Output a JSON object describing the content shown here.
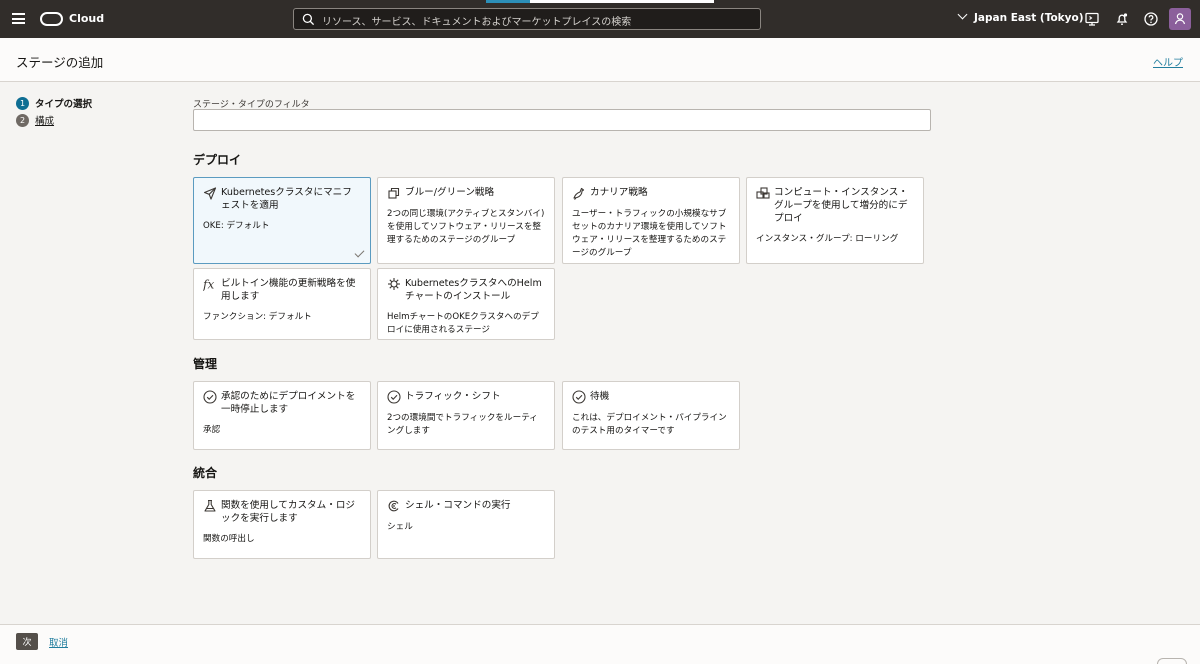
{
  "topbar": {
    "brand": "Cloud",
    "search_placeholder": "リソース、サービス、ドキュメントおよびマーケットプレイスの検索",
    "region": "Japan East (Tokyo)"
  },
  "header": {
    "title": "ステージの追加",
    "help": "ヘルプ"
  },
  "steps": [
    {
      "num": "1",
      "label": "タイプの選択"
    },
    {
      "num": "2",
      "label": "構成"
    }
  ],
  "filter": {
    "label": "ステージ・タイプのフィルタ",
    "value": ""
  },
  "sections": {
    "deploy": "デプロイ",
    "manage": "管理",
    "integration": "統合"
  },
  "cards": {
    "oke": {
      "title": "Kubernetesクラスタにマニフェストを適用",
      "desc": "OKE: デフォルト"
    },
    "bluegreen": {
      "title": "ブルー/グリーン戦略",
      "desc": "2つの同じ環境(アクティブとスタンバイ)を使用してソフトウェア・リリースを整理するためのステージのグループ"
    },
    "canary": {
      "title": "カナリア戦略",
      "desc": "ユーザー・トラフィックの小規模なサブセットのカナリア環境を使用してソフトウェア・リリースを整理するためのステージのグループ"
    },
    "instance": {
      "title": "コンピュート・インスタンス・グループを使用して増分的にデプロイ",
      "desc": "インスタンス・グループ: ローリング"
    },
    "function": {
      "title": "ビルトイン機能の更新戦略を使用します",
      "desc": "ファンクション: デフォルト"
    },
    "helm": {
      "title": "KubernetesクラスタへのHelmチャートのインストール",
      "desc": "HelmチャートのOKEクラスタへのデプロイに使用されるステージ"
    },
    "approval": {
      "title": "承認のためにデプロイメントを一時停止します",
      "desc": "承認"
    },
    "traffic": {
      "title": "トラフィック・シフト",
      "desc": "2つの環境間でトラフィックをルーティングします"
    },
    "wait": {
      "title": "待機",
      "desc": "これは、デプロイメント・パイプラインのテスト用のタイマーです"
    },
    "custom": {
      "title": "関数を使用してカスタム・ロジックを実行します",
      "desc": "関数の呼出し"
    },
    "shell": {
      "title": "シェル・コマンドの実行",
      "desc": "シェル"
    }
  },
  "footer": {
    "next": "次",
    "cancel": "取消"
  }
}
